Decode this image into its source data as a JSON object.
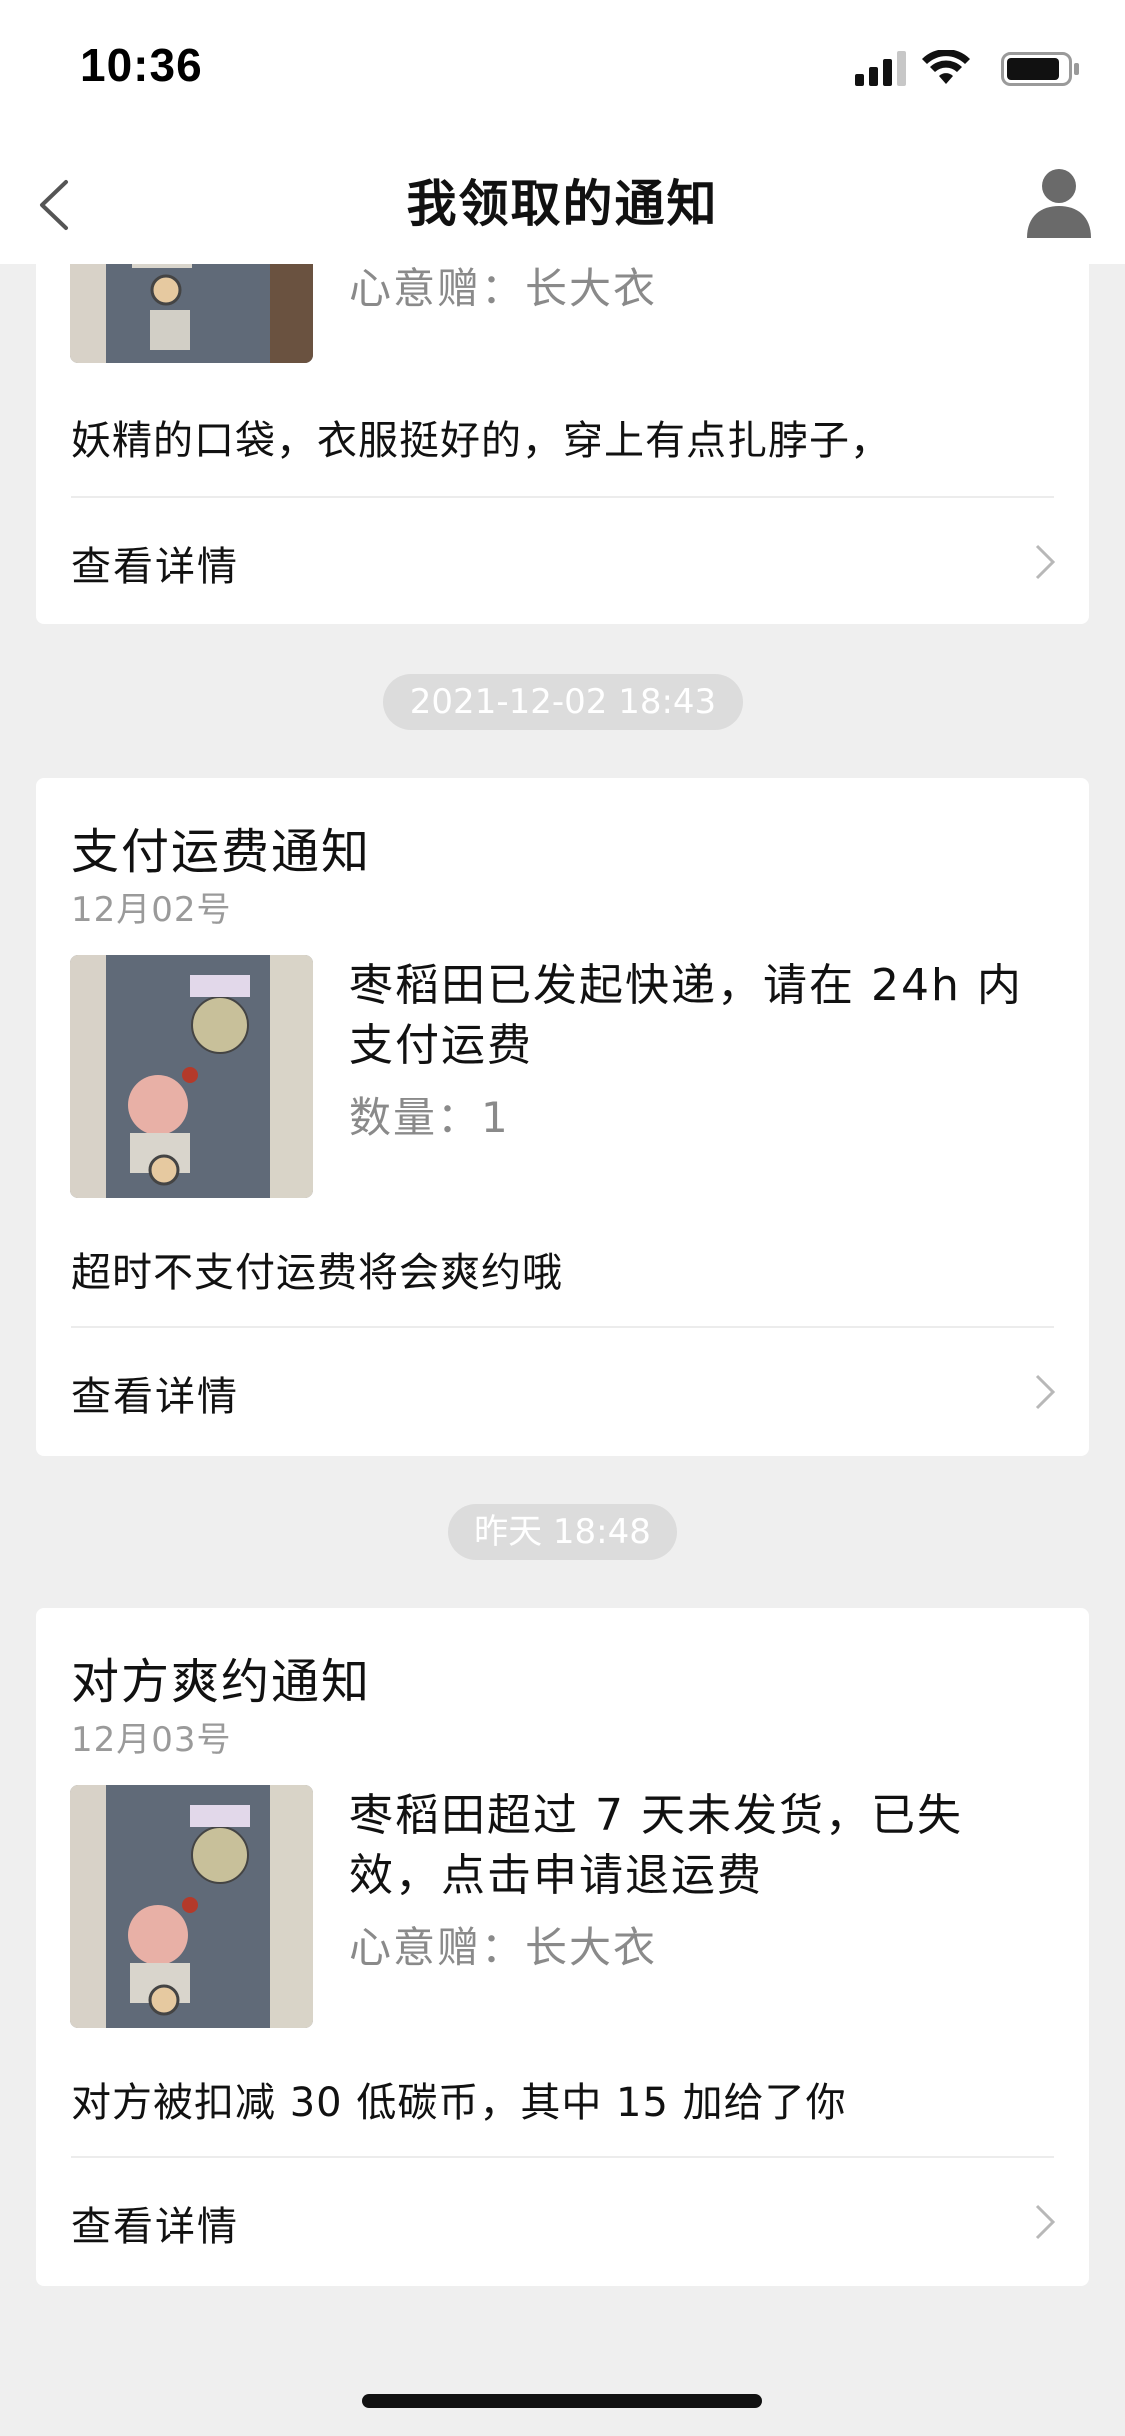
{
  "status_bar": {
    "time": "10:36"
  },
  "nav": {
    "title": "我领取的通知"
  },
  "cards": [
    {
      "meta": "心意赠：长大衣",
      "note": "妖精的口袋，衣服挺好的，穿上有点扎脖子，",
      "detail_label": "查看详情"
    },
    {
      "timestamp": "2021-12-02 18:43",
      "title": "支付运费通知",
      "date": "12月02号",
      "body": "枣稻田已发起快递，请在 24h 内支付运费",
      "meta": "数量：1",
      "note": "超时不支付运费将会爽约哦",
      "detail_label": "查看详情"
    },
    {
      "timestamp": "昨天 18:48",
      "title": "对方爽约通知",
      "date": "12月03号",
      "body": "枣稻田超过 7 天未发货，已失效，点击申请退运费",
      "meta": "心意赠：长大衣",
      "note": "对方被扣减 30 低碳币，其中 15 加给了你",
      "detail_label": "查看详情"
    }
  ],
  "icons": {
    "back": "chevron-left-icon",
    "profile": "user-icon",
    "detail": "chevron-right-icon"
  },
  "colors": {
    "background": "#efefef",
    "card": "#ffffff",
    "secondary_text": "#8a8a8a",
    "pill": "#dcdcdc"
  }
}
